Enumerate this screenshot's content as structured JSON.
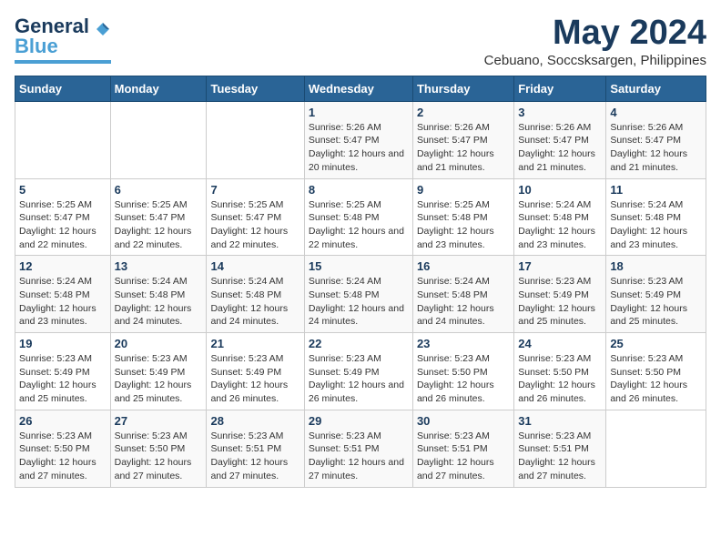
{
  "logo": {
    "line1": "General",
    "line2": "Blue"
  },
  "title": "May 2024",
  "subtitle": "Cebuano, Soccsksargen, Philippines",
  "days_of_week": [
    "Sunday",
    "Monday",
    "Tuesday",
    "Wednesday",
    "Thursday",
    "Friday",
    "Saturday"
  ],
  "weeks": [
    [
      {
        "day": "",
        "sunrise": "",
        "sunset": "",
        "daylight": ""
      },
      {
        "day": "",
        "sunrise": "",
        "sunset": "",
        "daylight": ""
      },
      {
        "day": "",
        "sunrise": "",
        "sunset": "",
        "daylight": ""
      },
      {
        "day": "1",
        "sunrise": "Sunrise: 5:26 AM",
        "sunset": "Sunset: 5:47 PM",
        "daylight": "Daylight: 12 hours and 20 minutes."
      },
      {
        "day": "2",
        "sunrise": "Sunrise: 5:26 AM",
        "sunset": "Sunset: 5:47 PM",
        "daylight": "Daylight: 12 hours and 21 minutes."
      },
      {
        "day": "3",
        "sunrise": "Sunrise: 5:26 AM",
        "sunset": "Sunset: 5:47 PM",
        "daylight": "Daylight: 12 hours and 21 minutes."
      },
      {
        "day": "4",
        "sunrise": "Sunrise: 5:26 AM",
        "sunset": "Sunset: 5:47 PM",
        "daylight": "Daylight: 12 hours and 21 minutes."
      }
    ],
    [
      {
        "day": "5",
        "sunrise": "Sunrise: 5:25 AM",
        "sunset": "Sunset: 5:47 PM",
        "daylight": "Daylight: 12 hours and 22 minutes."
      },
      {
        "day": "6",
        "sunrise": "Sunrise: 5:25 AM",
        "sunset": "Sunset: 5:47 PM",
        "daylight": "Daylight: 12 hours and 22 minutes."
      },
      {
        "day": "7",
        "sunrise": "Sunrise: 5:25 AM",
        "sunset": "Sunset: 5:47 PM",
        "daylight": "Daylight: 12 hours and 22 minutes."
      },
      {
        "day": "8",
        "sunrise": "Sunrise: 5:25 AM",
        "sunset": "Sunset: 5:48 PM",
        "daylight": "Daylight: 12 hours and 22 minutes."
      },
      {
        "day": "9",
        "sunrise": "Sunrise: 5:25 AM",
        "sunset": "Sunset: 5:48 PM",
        "daylight": "Daylight: 12 hours and 23 minutes."
      },
      {
        "day": "10",
        "sunrise": "Sunrise: 5:24 AM",
        "sunset": "Sunset: 5:48 PM",
        "daylight": "Daylight: 12 hours and 23 minutes."
      },
      {
        "day": "11",
        "sunrise": "Sunrise: 5:24 AM",
        "sunset": "Sunset: 5:48 PM",
        "daylight": "Daylight: 12 hours and 23 minutes."
      }
    ],
    [
      {
        "day": "12",
        "sunrise": "Sunrise: 5:24 AM",
        "sunset": "Sunset: 5:48 PM",
        "daylight": "Daylight: 12 hours and 23 minutes."
      },
      {
        "day": "13",
        "sunrise": "Sunrise: 5:24 AM",
        "sunset": "Sunset: 5:48 PM",
        "daylight": "Daylight: 12 hours and 24 minutes."
      },
      {
        "day": "14",
        "sunrise": "Sunrise: 5:24 AM",
        "sunset": "Sunset: 5:48 PM",
        "daylight": "Daylight: 12 hours and 24 minutes."
      },
      {
        "day": "15",
        "sunrise": "Sunrise: 5:24 AM",
        "sunset": "Sunset: 5:48 PM",
        "daylight": "Daylight: 12 hours and 24 minutes."
      },
      {
        "day": "16",
        "sunrise": "Sunrise: 5:24 AM",
        "sunset": "Sunset: 5:48 PM",
        "daylight": "Daylight: 12 hours and 24 minutes."
      },
      {
        "day": "17",
        "sunrise": "Sunrise: 5:23 AM",
        "sunset": "Sunset: 5:49 PM",
        "daylight": "Daylight: 12 hours and 25 minutes."
      },
      {
        "day": "18",
        "sunrise": "Sunrise: 5:23 AM",
        "sunset": "Sunset: 5:49 PM",
        "daylight": "Daylight: 12 hours and 25 minutes."
      }
    ],
    [
      {
        "day": "19",
        "sunrise": "Sunrise: 5:23 AM",
        "sunset": "Sunset: 5:49 PM",
        "daylight": "Daylight: 12 hours and 25 minutes."
      },
      {
        "day": "20",
        "sunrise": "Sunrise: 5:23 AM",
        "sunset": "Sunset: 5:49 PM",
        "daylight": "Daylight: 12 hours and 25 minutes."
      },
      {
        "day": "21",
        "sunrise": "Sunrise: 5:23 AM",
        "sunset": "Sunset: 5:49 PM",
        "daylight": "Daylight: 12 hours and 26 minutes."
      },
      {
        "day": "22",
        "sunrise": "Sunrise: 5:23 AM",
        "sunset": "Sunset: 5:49 PM",
        "daylight": "Daylight: 12 hours and 26 minutes."
      },
      {
        "day": "23",
        "sunrise": "Sunrise: 5:23 AM",
        "sunset": "Sunset: 5:50 PM",
        "daylight": "Daylight: 12 hours and 26 minutes."
      },
      {
        "day": "24",
        "sunrise": "Sunrise: 5:23 AM",
        "sunset": "Sunset: 5:50 PM",
        "daylight": "Daylight: 12 hours and 26 minutes."
      },
      {
        "day": "25",
        "sunrise": "Sunrise: 5:23 AM",
        "sunset": "Sunset: 5:50 PM",
        "daylight": "Daylight: 12 hours and 26 minutes."
      }
    ],
    [
      {
        "day": "26",
        "sunrise": "Sunrise: 5:23 AM",
        "sunset": "Sunset: 5:50 PM",
        "daylight": "Daylight: 12 hours and 27 minutes."
      },
      {
        "day": "27",
        "sunrise": "Sunrise: 5:23 AM",
        "sunset": "Sunset: 5:50 PM",
        "daylight": "Daylight: 12 hours and 27 minutes."
      },
      {
        "day": "28",
        "sunrise": "Sunrise: 5:23 AM",
        "sunset": "Sunset: 5:51 PM",
        "daylight": "Daylight: 12 hours and 27 minutes."
      },
      {
        "day": "29",
        "sunrise": "Sunrise: 5:23 AM",
        "sunset": "Sunset: 5:51 PM",
        "daylight": "Daylight: 12 hours and 27 minutes."
      },
      {
        "day": "30",
        "sunrise": "Sunrise: 5:23 AM",
        "sunset": "Sunset: 5:51 PM",
        "daylight": "Daylight: 12 hours and 27 minutes."
      },
      {
        "day": "31",
        "sunrise": "Sunrise: 5:23 AM",
        "sunset": "Sunset: 5:51 PM",
        "daylight": "Daylight: 12 hours and 27 minutes."
      },
      {
        "day": "",
        "sunrise": "",
        "sunset": "",
        "daylight": ""
      }
    ]
  ]
}
